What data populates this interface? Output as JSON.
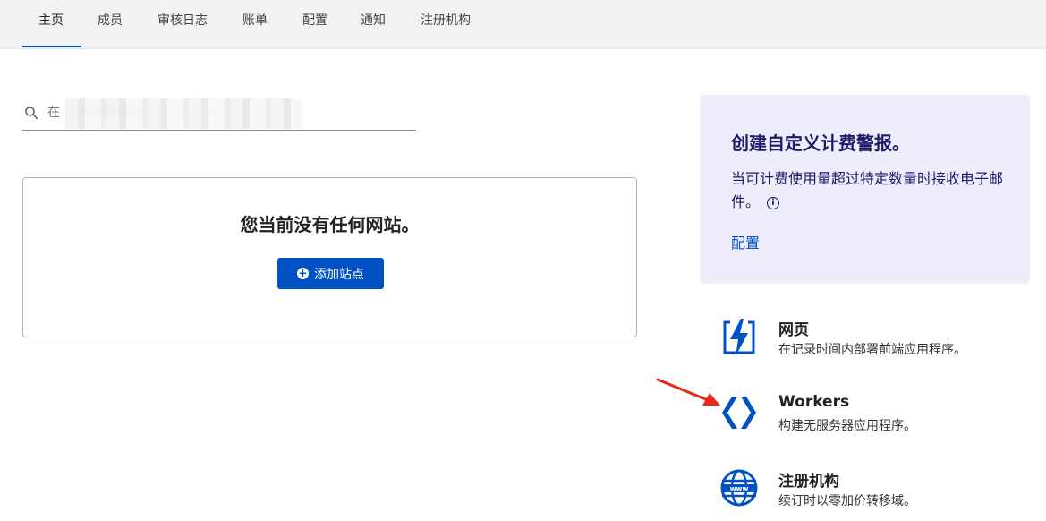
{
  "nav": {
    "tabs": [
      {
        "label": "主页",
        "active": true
      },
      {
        "label": "成员"
      },
      {
        "label": "审核日志"
      },
      {
        "label": "账单"
      },
      {
        "label": "配置"
      },
      {
        "label": "通知"
      },
      {
        "label": "注册机构"
      }
    ]
  },
  "search": {
    "placeholder": "在 … 中搜索网站..."
  },
  "empty_state": {
    "title": "您当前没有任何网站。",
    "add_button": "添加站点"
  },
  "alert_card": {
    "title": "创建自定义计费警报。",
    "description": "当可计费使用量超过特定数量时接收电子邮件。",
    "link": "配置",
    "info_icon": "i"
  },
  "products": [
    {
      "icon": "pages-lightning-icon",
      "title": "网页",
      "description": "在记录时间内部署前端应用程序。"
    },
    {
      "icon": "workers-chevrons-icon",
      "title": "Workers",
      "description": "构建无服务器应用程序。"
    },
    {
      "icon": "globe-www-icon",
      "title": "注册机构",
      "description": "续订时以零加价转移域。"
    }
  ],
  "colors": {
    "accent": "#0051c3",
    "alert_bg": "#eeedfb",
    "alert_text": "#1d1a66",
    "annotation_arrow": "#e8261c"
  }
}
